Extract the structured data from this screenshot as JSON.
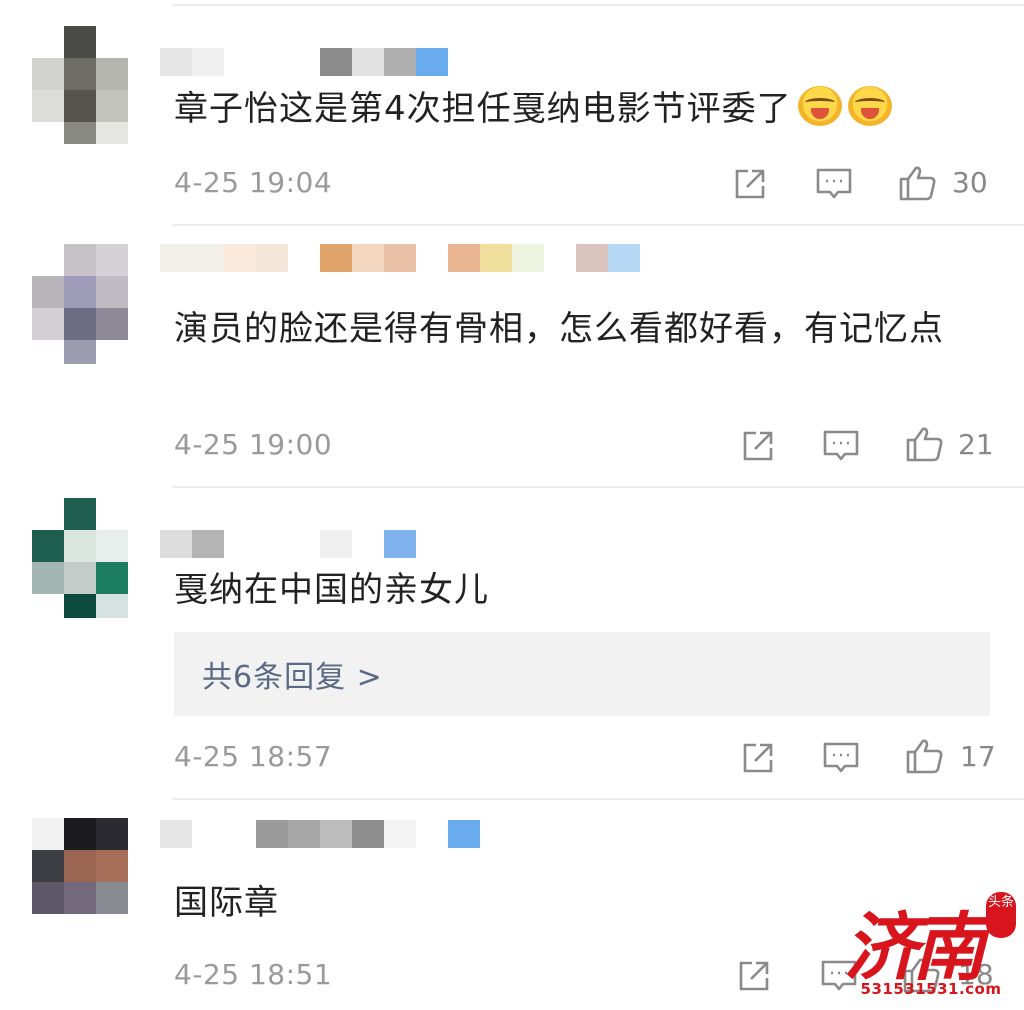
{
  "comments": [
    {
      "text": "章子怡这是第4次担任戛纳电影节评委了",
      "emojis": [
        "crying-laughing-emoji",
        "crying-laughing-emoji"
      ],
      "time": "4-25 19:04",
      "likes": "30"
    },
    {
      "text": "演员的脸还是得有骨相，怎么看都好看，有记忆点",
      "time": "4-25 19:00",
      "likes": "21"
    },
    {
      "text": "戛纳在中国的亲女儿",
      "replies": "共6条回复 >",
      "time": "4-25 18:57",
      "likes": "17"
    },
    {
      "text": "国际章",
      "time": "4-25 18:51",
      "likes": "18"
    }
  ],
  "icons": {
    "share": "share-icon",
    "comment": "comment-icon",
    "like": "thumbs-up-icon"
  },
  "colors": {
    "time": "#9a9a9a",
    "reply_link": "#5a6a85",
    "reply_bg": "#f2f2f2",
    "watermark": "#d8141c"
  },
  "watermark": {
    "brand": "济南",
    "badge": "头条",
    "url": "531531531.com"
  }
}
